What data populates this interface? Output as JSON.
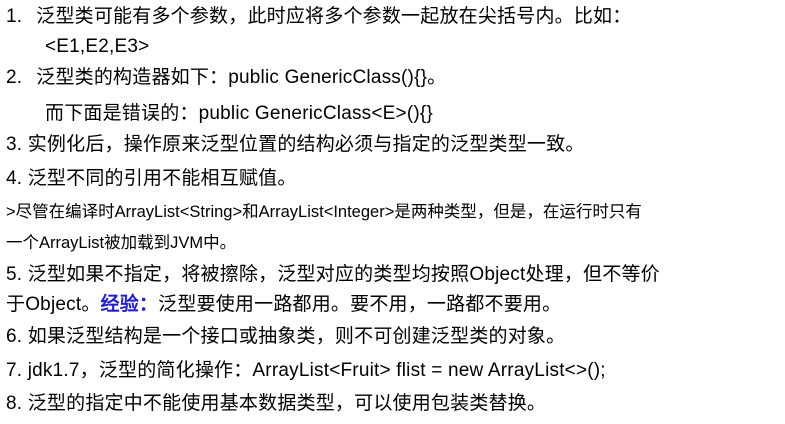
{
  "items": [
    {
      "num": "1.",
      "text": "泛型类可能有多个参数，此时应将多个参数一起放在尖括号内。比如：",
      "cont": "<E1,E2,E3>"
    },
    {
      "num": "2.",
      "text": "泛型类的构造器如下：public GenericClass(){}。",
      "cont": "而下面是错误的：public GenericClass<E>(){}"
    },
    {
      "num": "3.",
      "text": "实例化后，操作原来泛型位置的结构必须与指定的泛型类型一致。"
    },
    {
      "num": "4.",
      "text": "泛型不同的引用不能相互赋值。"
    },
    {
      "note_line1": ">尽管在编译时ArrayList<String>和ArrayList<Integer>是两种类型，但是，在运行时只有",
      "note_line2": "一个ArrayList被加载到JVM中。"
    },
    {
      "num": "5.",
      "text": "泛型如果不指定，将被擦除，泛型对应的类型均按照Object处理，但不等价",
      "cont_pre": "于Object。",
      "cont_hl": "经验：",
      "cont_post": "泛型要使用一路都用。要不用，一路都不要用。"
    },
    {
      "num": "6.",
      "text": "如果泛型结构是一个接口或抽象类，则不可创建泛型类的对象。"
    },
    {
      "num": "7.",
      "text": "jdk1.7，泛型的简化操作：ArrayList<Fruit> flist = new ArrayList<>();"
    },
    {
      "num": "8.",
      "text": "泛型的指定中不能使用基本数据类型，可以使用包装类替换。"
    }
  ],
  "colors": {
    "text": "#000000",
    "highlight": "#1f1fd6",
    "background": "#ffffff"
  }
}
